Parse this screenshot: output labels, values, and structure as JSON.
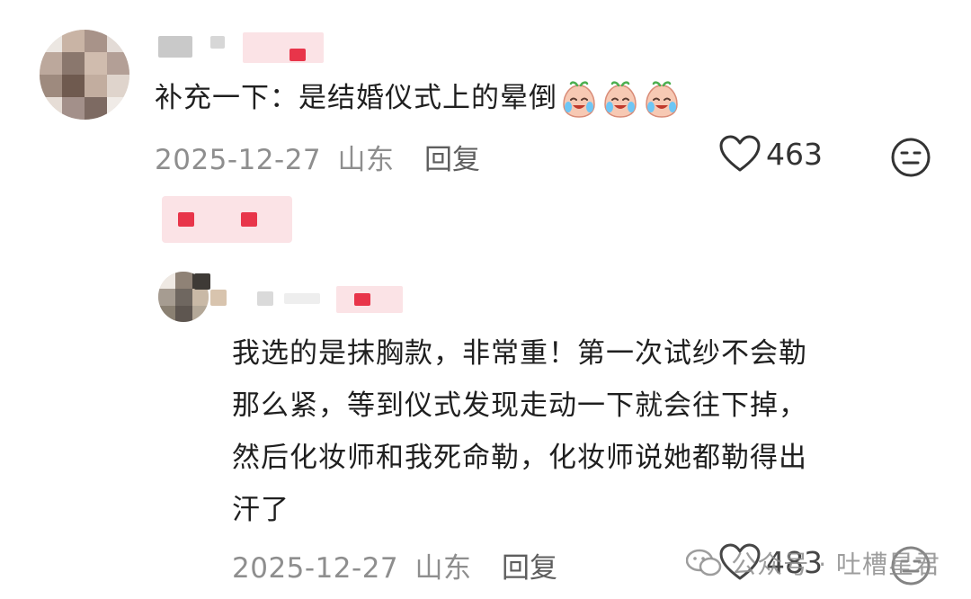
{
  "comment1": {
    "text": "补充一下：是结婚仪式上的晕倒",
    "emoji_count": 3,
    "date": "2025-12-27",
    "location": "山东",
    "reply_label": "回复",
    "likes": "463"
  },
  "comment2": {
    "text_lines": [
      "我选的是抹胸款，非常重！第一次试纱不会勒",
      "那么紧，等到仪式发现走动一下就会往下掉，",
      "然后化妆师和我死命勒，化妆师说她都勒得出",
      "汗了"
    ],
    "date": "2025-12-27",
    "location": "山东",
    "reply_label": "回复",
    "likes": "483"
  },
  "watermark": {
    "text": "公众号 · 吐槽星君"
  },
  "colors": {
    "accent_red": "#e8354a",
    "blur_pink": "#fbe3e6",
    "meta_gray": "#8e8e8e"
  }
}
